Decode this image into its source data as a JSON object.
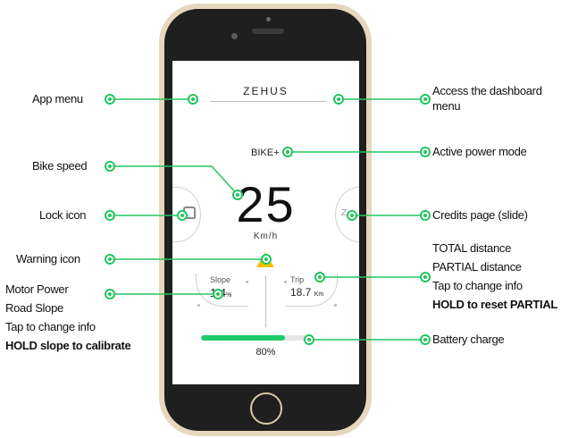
{
  "screen": {
    "brand": "ZEHUS",
    "power_mode": "BIKE+",
    "speed": "25",
    "speed_unit": "Km/h",
    "slope_label": "Slope",
    "slope_value": "1.4",
    "slope_unit": "%",
    "trip_label": "Trip",
    "trip_value": "18.7",
    "trip_unit": "Km",
    "battery_percent": "80%",
    "battery_level": 0.8
  },
  "callouts": {
    "app_menu": "App menu",
    "bike_speed": "Bike speed",
    "lock_icon": "Lock icon",
    "warning_icon": "Warning icon",
    "motor_power": "Motor Power",
    "road_slope": "Road Slope",
    "tap_change_left": "Tap to change info",
    "hold_slope": "HOLD slope to calibrate",
    "access_dashboard": "Access the dashboard menu",
    "active_power_mode": "Active power mode",
    "credits_page": "Credits page (slide)",
    "total_distance": "TOTAL distance",
    "partial_distance": "PARTIAL distance",
    "tap_change_right": "Tap to change info",
    "hold_reset": "HOLD to reset PARTIAL",
    "battery_charge": "Battery charge"
  },
  "colors": {
    "accent": "#22c55e",
    "battery": "#1ecb6b",
    "warning": "#f2c200",
    "phone_frame": "#e6d8bd"
  }
}
